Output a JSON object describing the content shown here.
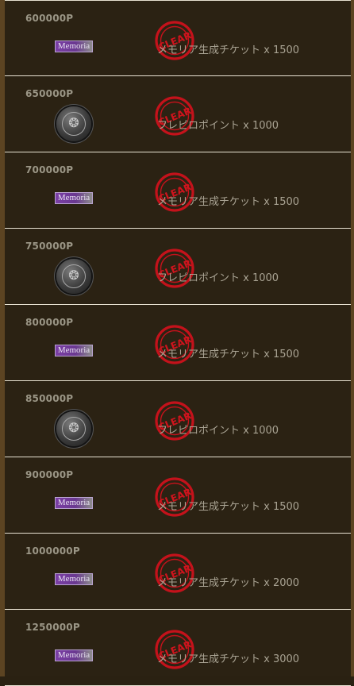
{
  "stamp_text": "CLEAR",
  "rewards": [
    {
      "points": "600000P",
      "icon": "memoria",
      "item_label": "Memoria",
      "reward": "メモリア生成チケット x 1500"
    },
    {
      "points": "650000P",
      "icon": "coin",
      "item_label": "",
      "reward": "フレピロポイント x 1000"
    },
    {
      "points": "700000P",
      "icon": "memoria",
      "item_label": "Memoria",
      "reward": "メモリア生成チケット x 1500"
    },
    {
      "points": "750000P",
      "icon": "coin",
      "item_label": "",
      "reward": "フレピロポイント x 1000"
    },
    {
      "points": "800000P",
      "icon": "memoria",
      "item_label": "Memoria",
      "reward": "メモリア生成チケット x 1500"
    },
    {
      "points": "850000P",
      "icon": "coin",
      "item_label": "",
      "reward": "フレピロポイント x 1000"
    },
    {
      "points": "900000P",
      "icon": "memoria",
      "item_label": "Memoria",
      "reward": "メモリア生成チケット x 1500"
    },
    {
      "points": "1000000P",
      "icon": "memoria",
      "item_label": "Memoria",
      "reward": "メモリア生成チケット x 2000"
    },
    {
      "points": "1250000P",
      "icon": "memoria",
      "item_label": "Memoria",
      "reward": "メモリア生成チケット x 3000"
    }
  ]
}
